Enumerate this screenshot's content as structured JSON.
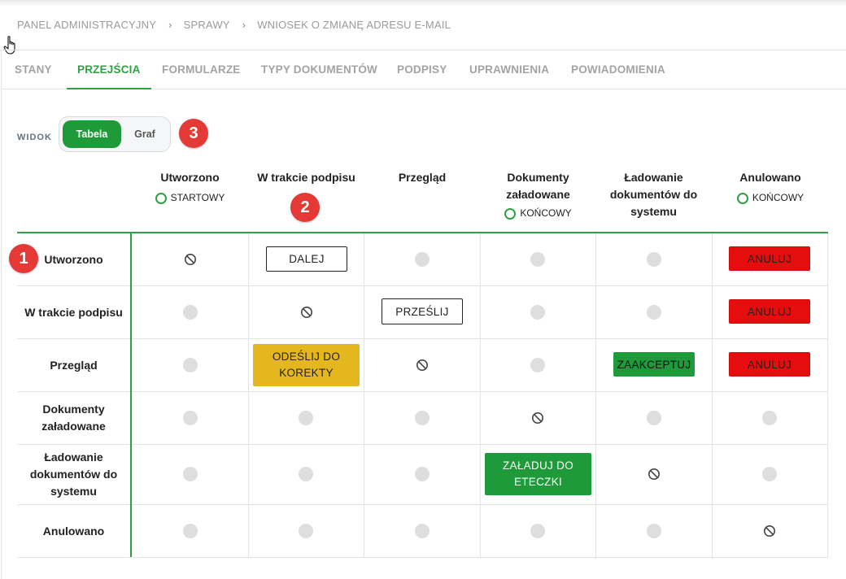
{
  "breadcrumb": [
    "PANEL ADMINISTRACYJNY",
    "SPRAWY",
    "WNIOSEK O ZMIANĘ ADRESU E-MAIL"
  ],
  "breadcrumb_separator": "›",
  "tabs": [
    {
      "label": "STANY",
      "active": false
    },
    {
      "label": "PRZEJŚCIA",
      "active": true
    },
    {
      "label": "FORMULARZE",
      "active": false
    },
    {
      "label": "TYPY DOKUMENTÓW",
      "active": false
    },
    {
      "label": "PODPISY",
      "active": false
    },
    {
      "label": "UPRAWNIENIA",
      "active": false
    },
    {
      "label": "POWIADOMIENIA",
      "active": false
    }
  ],
  "view": {
    "label": "WIDOK",
    "options": [
      {
        "label": "Tabela",
        "selected": true
      },
      {
        "label": "Graf",
        "selected": false
      }
    ]
  },
  "badges": [
    "1",
    "2",
    "3"
  ],
  "columns": [
    {
      "name": "Utworzono",
      "tag": "STARTOWY"
    },
    {
      "name": "W trakcie podpisu",
      "tag": ""
    },
    {
      "name": "Przegląd",
      "tag": ""
    },
    {
      "name": "Dokumenty załadowane",
      "tag": "KOŃCOWY"
    },
    {
      "name": "Ładowanie dokumentów do systemu",
      "tag": ""
    },
    {
      "name": "Anulowano",
      "tag": "KOŃCOWY"
    }
  ],
  "rows": [
    {
      "name": "Utworzono",
      "cells": [
        "none",
        "DALEJ",
        "empty",
        "empty",
        "empty",
        "ANULUJ"
      ]
    },
    {
      "name": "W trakcie podpisu",
      "cells": [
        "empty",
        "none",
        "PRZEŚLIJ",
        "empty",
        "empty",
        "ANULUJ"
      ]
    },
    {
      "name": "Przegląd",
      "cells": [
        "empty",
        "ODEŚLIJ DO KOREKTY",
        "none",
        "empty",
        "ZAAKCEPTUJ",
        "ANULUJ"
      ]
    },
    {
      "name": "Dokumenty załadowane",
      "cells": [
        "empty",
        "empty",
        "empty",
        "none",
        "empty",
        "empty"
      ]
    },
    {
      "name": "Ładowanie dokumentów do systemu",
      "cells": [
        "empty",
        "empty",
        "empty",
        "ZAŁADUJ DO ETECZKI",
        "none",
        "empty"
      ]
    },
    {
      "name": "Anulowano",
      "cells": [
        "empty",
        "empty",
        "empty",
        "empty",
        "empty",
        "none"
      ]
    }
  ],
  "colors": {
    "accent_green": "#2fa044",
    "button_green": "#1f9a3a",
    "button_red": "#e50d0d",
    "button_yellow": "#e5b71e",
    "badge_red": "#e53935",
    "empty_dot": "#dedede"
  }
}
